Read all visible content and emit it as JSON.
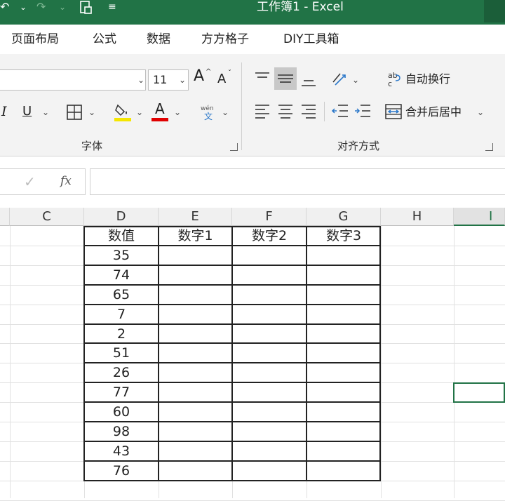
{
  "window": {
    "title": "工作簿1  -  Excel"
  },
  "ribbon_tabs": [
    "页面布局",
    "公式",
    "数据",
    "方方格子",
    "DIY工具箱"
  ],
  "font_group": {
    "label": "字体",
    "font_size": "11",
    "grow_font": "A",
    "shrink_font": "A",
    "italic": "I",
    "underline": "U",
    "font_color_letter": "A",
    "phonetic_top": "wén",
    "phonetic_bottom": "文",
    "fill_color": "#f5e600",
    "font_color": "#e00000"
  },
  "align_group": {
    "label": "对齐方式",
    "wrap_text": "自动换行",
    "merge_center": "合并后居中"
  },
  "formula_bar": {
    "fx": "fx",
    "check": "✓"
  },
  "sheet": {
    "columns": [
      "C",
      "D",
      "E",
      "F",
      "G",
      "H",
      "I"
    ],
    "headers": [
      "数值",
      "数字1",
      "数字2",
      "数字3"
    ],
    "values": [
      "35",
      "74",
      "65",
      "7",
      "2",
      "51",
      "26",
      "77",
      "60",
      "98",
      "43",
      "76"
    ]
  },
  "colors": {
    "excel_green": "#217346"
  }
}
